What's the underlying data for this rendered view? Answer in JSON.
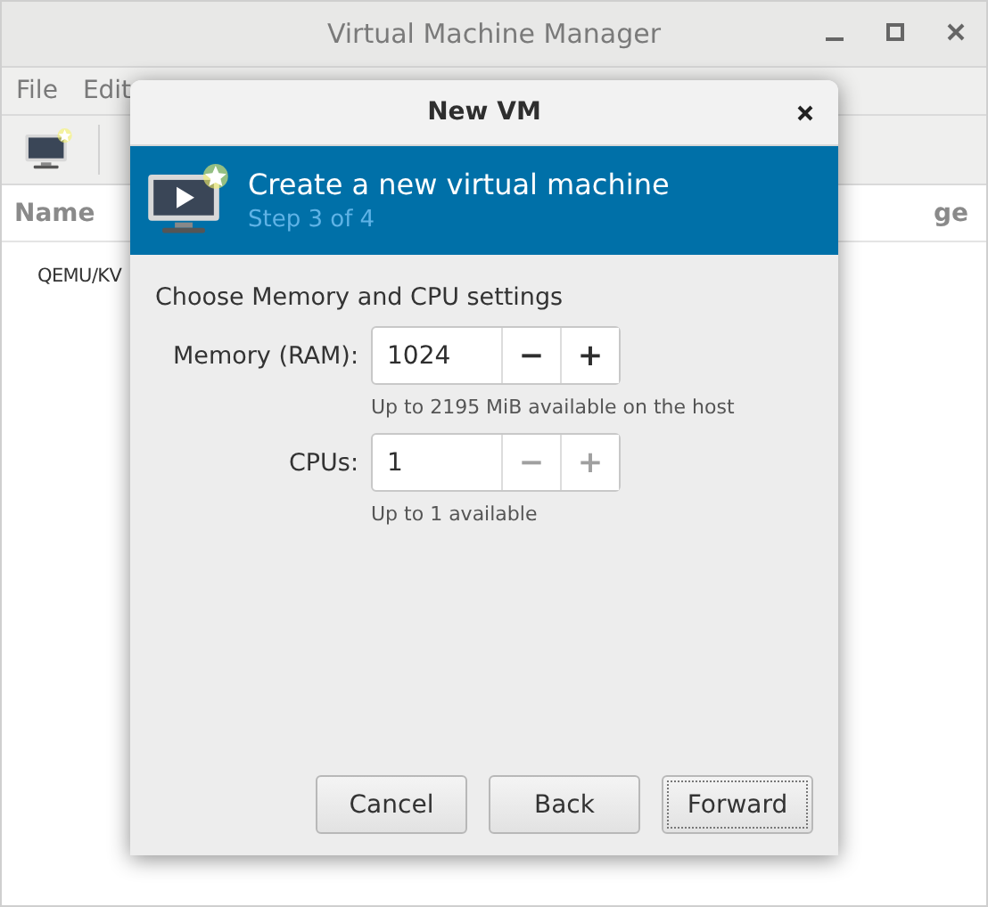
{
  "main_window": {
    "title": "Virtual Machine Manager",
    "menu": [
      "File",
      "Edit"
    ],
    "columns": [
      "Name",
      "ge"
    ],
    "rows": [
      "QEMU/KV"
    ]
  },
  "dialog": {
    "title": "New VM",
    "banner": {
      "title": "Create a new virtual machine",
      "step": "Step 3 of 4"
    },
    "heading": "Choose Memory and CPU settings",
    "fields": [
      {
        "label": "Memory (RAM):",
        "value": "1024",
        "decrement": "−",
        "increment": "+",
        "decrement_disabled": false,
        "increment_disabled": false,
        "hint": "Up to 2195 MiB available on the host"
      },
      {
        "label": "CPUs:",
        "value": "1",
        "decrement": "−",
        "increment": "+",
        "decrement_disabled": true,
        "increment_disabled": true,
        "hint": "Up to 1 available"
      }
    ],
    "buttons": [
      {
        "label": "Cancel",
        "focused": false
      },
      {
        "label": "Back",
        "focused": false
      },
      {
        "label": "Forward",
        "focused": true
      }
    ]
  }
}
